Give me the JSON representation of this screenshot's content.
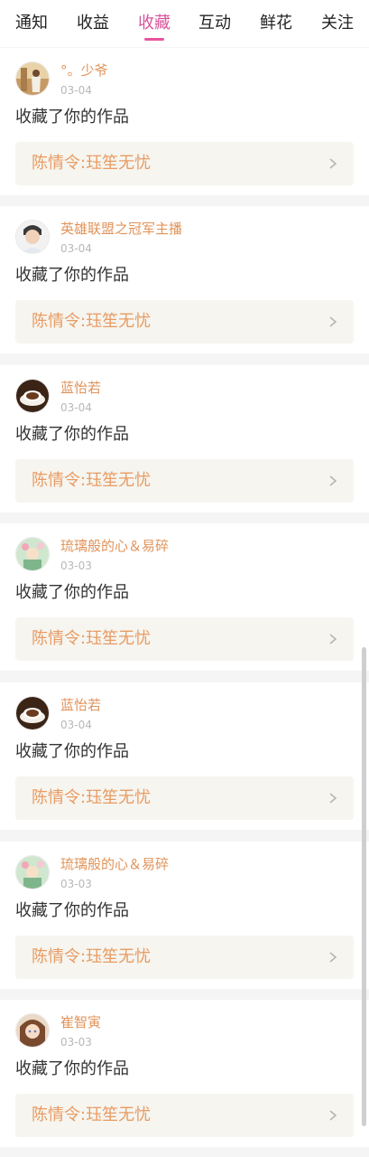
{
  "tabs": [
    {
      "label": "通知",
      "active": false
    },
    {
      "label": "收益",
      "active": false
    },
    {
      "label": "收藏",
      "active": true
    },
    {
      "label": "互动",
      "active": false
    },
    {
      "label": "鲜花",
      "active": false
    },
    {
      "label": "关注",
      "active": false
    }
  ],
  "colors": {
    "active_tab": "#d9549a",
    "username": "#e0935a",
    "work_title": "#e99b63",
    "work_box_bg": "#f6f5ef"
  },
  "feed": [
    {
      "user": "°。少爷",
      "date": "03-04",
      "action": "收藏了你的作品",
      "work": "陈情令:珏笙无忧",
      "avatar_icon": "girl-sunset-avatar-icon"
    },
    {
      "user": "英雄联盟之冠军主播",
      "date": "03-04",
      "action": "收藏了你的作品",
      "work": "陈情令:珏笙无忧",
      "avatar_icon": "boy-portrait-avatar-icon"
    },
    {
      "user": "蓝怡若",
      "date": "03-04",
      "action": "收藏了你的作品",
      "work": "陈情令:珏笙无忧",
      "avatar_icon": "coffee-cup-avatar-icon"
    },
    {
      "user": "琉璃般的心＆易碎",
      "date": "03-03",
      "action": "收藏了你的作品",
      "work": "陈情令:珏笙无忧",
      "avatar_icon": "flower-cartoon-avatar-icon"
    },
    {
      "user": "蓝怡若",
      "date": "03-04",
      "action": "收藏了你的作品",
      "work": "陈情令:珏笙无忧",
      "avatar_icon": "coffee-cup-avatar-icon"
    },
    {
      "user": "琉璃般的心＆易碎",
      "date": "03-03",
      "action": "收藏了你的作品",
      "work": "陈情令:珏笙无忧",
      "avatar_icon": "flower-cartoon-avatar-icon"
    },
    {
      "user": "崔智寅",
      "date": "03-03",
      "action": "收藏了你的作品",
      "work": "陈情令:珏笙无忧",
      "avatar_icon": "anime-girl-avatar-icon"
    }
  ]
}
